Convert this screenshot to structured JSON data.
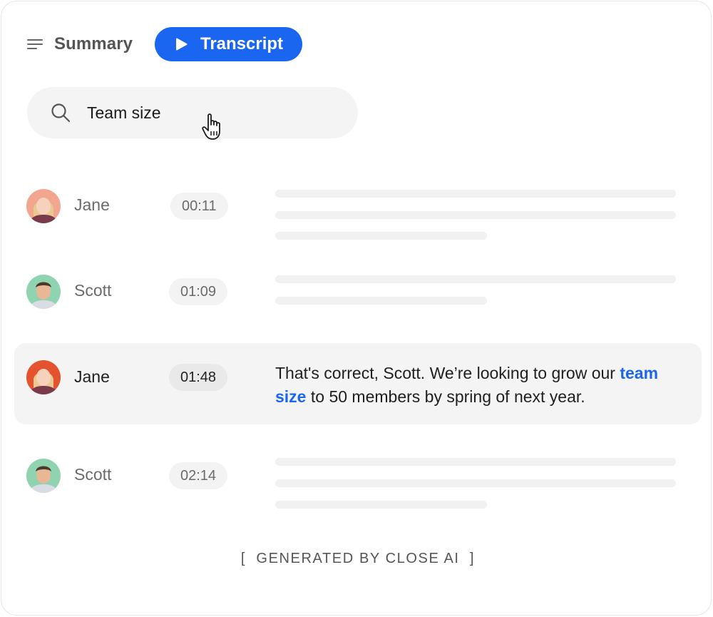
{
  "tabs": {
    "summary_label": "Summary",
    "transcript_label": "Transcript"
  },
  "search": {
    "value": "Team size"
  },
  "rows": [
    {
      "speaker": "Jane",
      "time": "00:11"
    },
    {
      "speaker": "Scott",
      "time": "01:09"
    },
    {
      "speaker": "Jane",
      "time": "01:48",
      "text_before": "That's correct, Scott. We’re looking to grow our ",
      "highlight": "team size",
      "text_after": " to 50 members by spring of next year."
    },
    {
      "speaker": "Scott",
      "time": "02:14"
    }
  ],
  "footer": {
    "open_bracket": "[",
    "label": "GENERATED BY CLOSE AI",
    "close_bracket": "]"
  },
  "colors": {
    "accent": "#1a66f0",
    "active_row_bg": "#f4f4f4",
    "placeholder_bar": "#f1f1f1"
  }
}
